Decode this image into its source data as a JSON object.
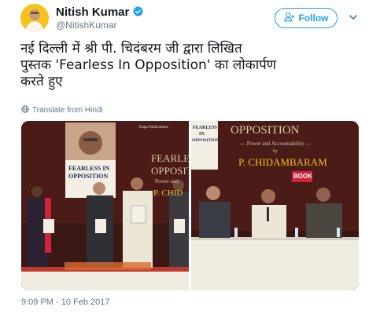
{
  "author": {
    "display_name": "Nitish Kumar",
    "handle": "@NitishKumar",
    "verified_icon": "verified-badge-icon"
  },
  "follow_button": {
    "label": "Follow",
    "icon": "add-user-icon"
  },
  "tweet": {
    "text": "नई दिल्ली में श्री पी. चिदंबरम जी द्वारा लिखित\nपुस्तक 'Fearless In Opposition' का लोकार्पण\nकरते हुए",
    "translate_label": "Translate from Hindi",
    "timestamp": "9:09 PM - 10 Feb 2017"
  },
  "photos": {
    "left": {
      "book_title_line1": "FEARLESS IN",
      "book_title_line2": "OPPOSITION",
      "banner_text_1": "FEARLESS IN",
      "banner_text_2": "OPPOSITIO",
      "banner_sub": "Power and",
      "banner_author": "P. CHID",
      "publisher": "Rupa Publications"
    },
    "right": {
      "banner_title": "OPPOSITION",
      "banner_sub": "— Power and Accountability —",
      "banner_by": "by",
      "banner_author": "P. CHIDAMBARAM",
      "book_title_line1": "FEARLESS",
      "book_title_line2": "IN",
      "book_title_line3": "OPPOSITION",
      "logo": "BOOK"
    }
  },
  "colors": {
    "link_blue": "#1da1f2",
    "text_primary": "#14171a",
    "text_secondary": "#657786",
    "banner_maroon": "#4a1b17"
  }
}
